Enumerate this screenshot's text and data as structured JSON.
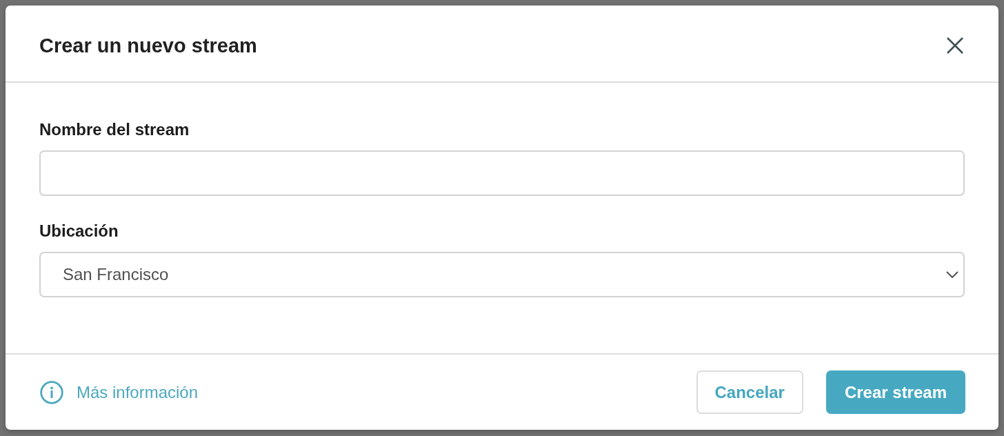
{
  "dialog": {
    "title": "Crear un nuevo stream"
  },
  "fields": [
    {
      "kind": "text",
      "label": "Nombre del stream"
    },
    {
      "kind": "select",
      "label": "Ubicación",
      "value": "San Francisco"
    }
  ],
  "footer": {
    "info_link": "Más información",
    "buttons": [
      {
        "kind": "secondary",
        "label": "Cancelar"
      },
      {
        "kind": "primary",
        "label": "Crear stream"
      }
    ]
  }
}
